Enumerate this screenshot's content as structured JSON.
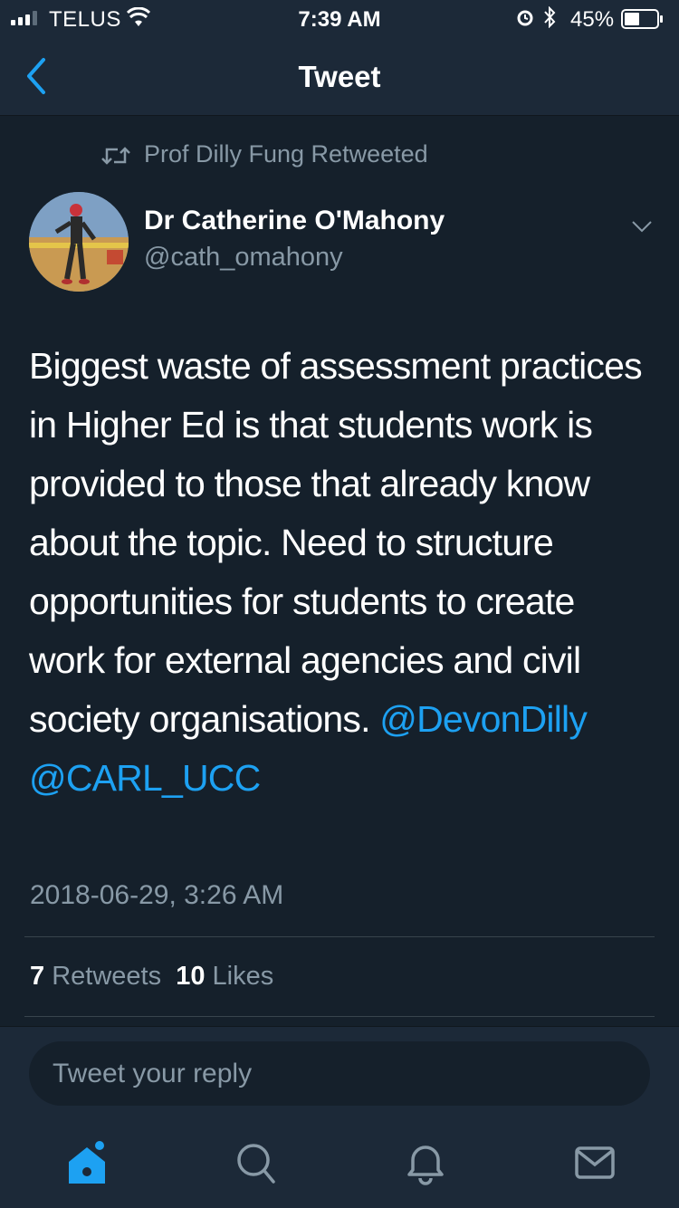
{
  "status_bar": {
    "carrier": "TELUS",
    "time": "7:39 AM",
    "battery": "45%"
  },
  "nav": {
    "title": "Tweet"
  },
  "tweet": {
    "retweet_context": "Prof Dilly Fung Retweeted",
    "author_name": "Dr Catherine O'Mahony",
    "author_handle": "@cath_omahony",
    "text": "Biggest waste of assessment practices in Higher Ed is that students work is provided to those that already know about the topic. Need to structure opportunities for students to create work for external agencies and civil society organisations.",
    "mentions": [
      "@DevonDilly",
      "@CARL_UCC"
    ],
    "timestamp": "2018-06-29, 3:26 AM",
    "retweets_count": "7",
    "retweets_label": "Retweets",
    "likes_count": "10",
    "likes_label": "Likes"
  },
  "reply": {
    "placeholder": "Tweet your reply"
  },
  "tab_bar": {
    "items": [
      "home-icon",
      "search-icon",
      "notifications-icon",
      "messages-icon"
    ]
  },
  "colors": {
    "background": "#15202b",
    "bar": "#1c2938",
    "accent": "#1da1f2",
    "secondary_text": "#8899a6"
  }
}
